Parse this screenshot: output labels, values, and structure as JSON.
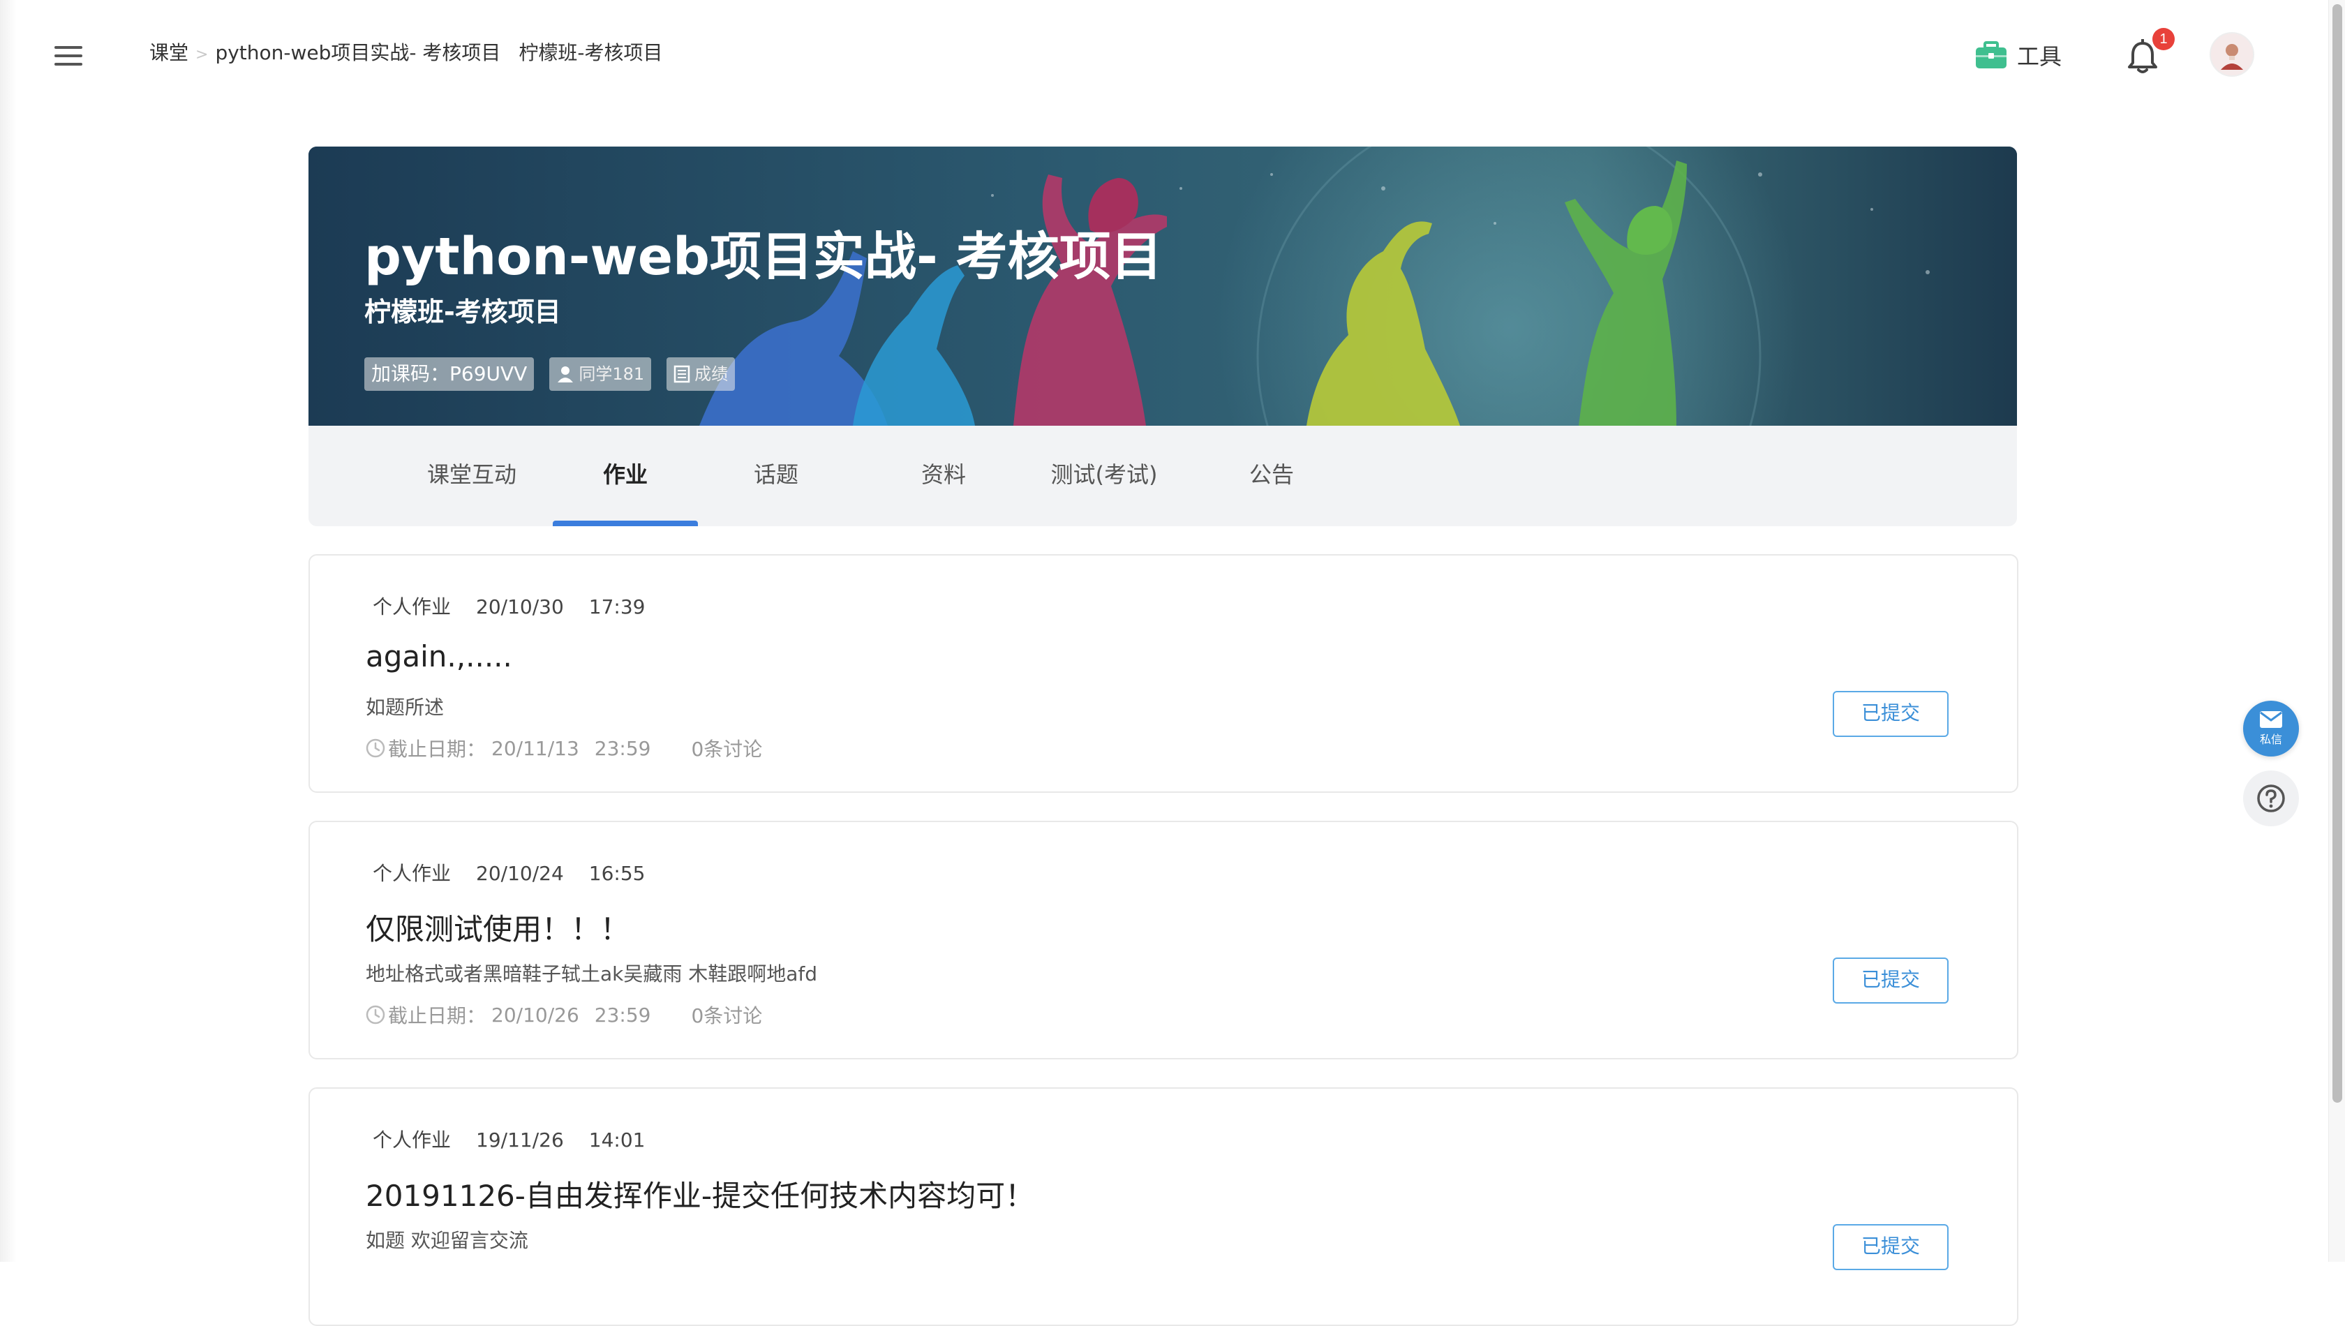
{
  "breadcrumb": {
    "root": "课堂",
    "separator": ">",
    "course": "python-web项目实战- 考核项目",
    "current": "柠檬班-考核项目"
  },
  "header": {
    "tools_label": "工具",
    "notification_count": "1"
  },
  "banner": {
    "title": "python-web项目实战- 考核项目",
    "class_name": "柠檬班-考核项目",
    "join_code": "加课码：P69UVV",
    "students": "同学181",
    "grades": "成绩"
  },
  "tabs": [
    {
      "label": "课堂互动"
    },
    {
      "label": "作业"
    },
    {
      "label": "话题"
    },
    {
      "label": "资料"
    },
    {
      "label": "测试(考试)"
    },
    {
      "label": "公告"
    }
  ],
  "assignments": [
    {
      "type": "个人作业",
      "date": "20/10/30",
      "time": "17:39",
      "title": "again.,.....",
      "desc": "如题所述",
      "deadline_label": "截止日期：",
      "deadline_date": "20/11/13",
      "deadline_time": "23:59",
      "discussions": "0条讨论",
      "status": "已提交"
    },
    {
      "type": "个人作业",
      "date": "20/10/24",
      "time": "16:55",
      "title": "仅限测试使用！！！",
      "desc": "地址格式或者黑暗鞋子轼土ak吴藏雨 木鞋跟啊地afd",
      "deadline_label": "截止日期：",
      "deadline_date": "20/10/26",
      "deadline_time": "23:59",
      "discussions": "0条讨论",
      "status": "已提交"
    },
    {
      "type": "个人作业",
      "date": "19/11/26",
      "time": "14:01",
      "title": "20191126-自由发挥作业-提交任何技术内容均可！",
      "desc": "如题 欢迎留言交流",
      "status": "已提交"
    }
  ],
  "side": {
    "message_label": "私信"
  },
  "colors": {
    "accent": "#3b7ddd",
    "submit_border": "#5aa9e6",
    "badge": "#e8413a",
    "tools_icon": "#3fbf8f"
  }
}
